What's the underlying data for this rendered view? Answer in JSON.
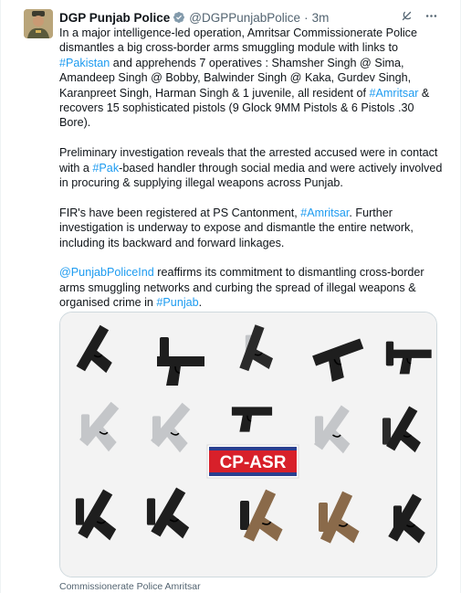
{
  "author": {
    "name": "DGP Punjab Police",
    "handle": "@DGPPunjabPolice",
    "separator": "·",
    "time": "3m"
  },
  "icons": {
    "verified": "verified-badge-icon",
    "grok": "grok-icon",
    "more": "more-icon"
  },
  "tweet": {
    "p1": [
      {
        "t": "In a major intelligence-led operation, Amritsar Commissionerate Police dismantles a big cross-border arms smuggling module with links to "
      },
      {
        "t": "#Pakistan",
        "link": true
      },
      {
        "t": " and apprehends 7 operatives : Shamsher Singh @ Sima, Amandeep Singh @ Bobby, Balwinder Singh @ Kaka, Gurdev Singh, Karanpreet Singh, Harman Singh & 1 juvenile, all resident of "
      },
      {
        "t": "#Amritsar",
        "link": true
      },
      {
        "t": " & recovers 15 sophisticated pistols (9 Glock 9MM Pistols & 6 Pistols .30 Bore)."
      }
    ],
    "p2": [
      {
        "t": "Preliminary investigation reveals that the arrested accused were in contact with a "
      },
      {
        "t": "#Pak",
        "link": true
      },
      {
        "t": "-based handler through social media and were actively involved in procuring & supplying illegal weapons across Punjab."
      }
    ],
    "p3": [
      {
        "t": "FIR's have been registered at PS Cantonment, "
      },
      {
        "t": "#Amritsar",
        "link": true
      },
      {
        "t": ". Further investigation is underway to expose and dismantle the entire network, including its backward and forward linkages."
      }
    ],
    "p4": [
      {
        "t": "@PunjabPoliceInd",
        "link": true
      },
      {
        "t": " reaffirms its commitment to dismantling cross-border arms smuggling networks and curbing the spread of illegal weapons & organised crime in "
      },
      {
        "t": "#Punjab",
        "link": true
      },
      {
        "t": "."
      }
    ]
  },
  "media": {
    "banner_text": "CP-ASR",
    "colors": {
      "banner_red": "#d8202a",
      "banner_blue": "#2a3f8f",
      "pistol_black": "#1e1e1e",
      "pistol_silver": "#c4c6c9",
      "pistol_tan": "#8a6a4a",
      "background": "#f3f3f3"
    }
  },
  "caption": "Commissionerate Police Amritsar",
  "colors": {
    "link": "#1d9bf0",
    "text": "#0f1419",
    "muted": "#536471"
  }
}
